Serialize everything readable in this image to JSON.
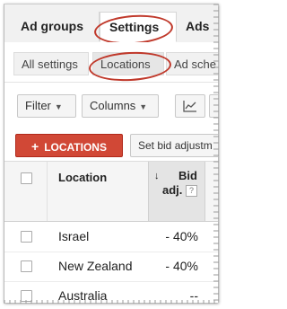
{
  "tabs": {
    "ad_groups": "Ad groups",
    "settings": "Settings",
    "ads": "Ads"
  },
  "subtabs": {
    "all_settings": "All settings",
    "locations": "Locations",
    "ad_schedule": "Ad sche"
  },
  "toolbar": {
    "filter": "Filter",
    "columns": "Columns",
    "chart_icon": "line-chart-icon"
  },
  "actions": {
    "add_locations": "LOCATIONS",
    "add_icon": "+",
    "set_bid": "Set bid adjustm"
  },
  "table": {
    "headers": {
      "location": "Location",
      "bid_adj_line1": "Bid",
      "bid_adj_line2": "adj.",
      "sort_indicator": "↓",
      "help": "?"
    },
    "rows": [
      {
        "location": "Israel",
        "bid_adj": "- 40%"
      },
      {
        "location": "New Zealand",
        "bid_adj": "- 40%"
      },
      {
        "location": "Australia",
        "bid_adj": "--"
      }
    ]
  },
  "colors": {
    "accent_red": "#d14836",
    "annotation_circle": "#c0392b"
  }
}
